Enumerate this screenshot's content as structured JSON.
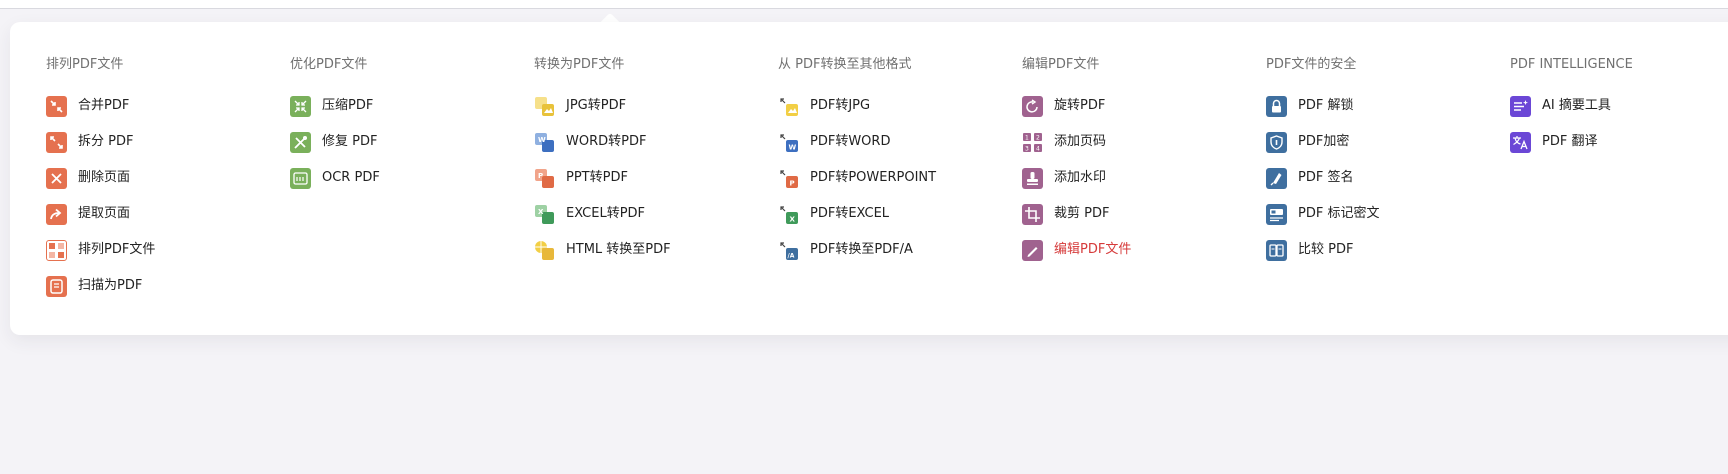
{
  "colors": {
    "organize": "#e5714f",
    "optimize": "#7ab05b",
    "convert_to": "#e8b83a",
    "edit": "#a0628f",
    "security": "#3f6f9f",
    "intelligence": "#6b47d6",
    "active_text": "#d63b3b"
  },
  "columns": [
    {
      "title": "排列PDF文件",
      "items": [
        {
          "label": "合并PDF",
          "icon": "merge-icon"
        },
        {
          "label": "拆分 PDF",
          "icon": "split-icon"
        },
        {
          "label": "删除页面",
          "icon": "remove-icon"
        },
        {
          "label": "提取页面",
          "icon": "extract-icon"
        },
        {
          "label": "排列PDF文件",
          "icon": "organize-icon"
        },
        {
          "label": "扫描为PDF",
          "icon": "scan-icon"
        }
      ]
    },
    {
      "title": "优化PDF文件",
      "items": [
        {
          "label": "压缩PDF",
          "icon": "compress-icon"
        },
        {
          "label": "修复 PDF",
          "icon": "repair-icon"
        },
        {
          "label": "OCR PDF",
          "icon": "ocr-icon"
        }
      ]
    },
    {
      "title": "转换为PDF文件",
      "items": [
        {
          "label": "JPG转PDF",
          "icon": "jpg-to-pdf-icon"
        },
        {
          "label": "WORD转PDF",
          "icon": "word-to-pdf-icon"
        },
        {
          "label": "PPT转PDF",
          "icon": "ppt-to-pdf-icon"
        },
        {
          "label": "EXCEL转PDF",
          "icon": "excel-to-pdf-icon"
        },
        {
          "label": "HTML 转换至PDF",
          "icon": "html-to-pdf-icon"
        }
      ]
    },
    {
      "title": "从 PDF转换至其他格式",
      "items": [
        {
          "label": "PDF转JPG",
          "icon": "pdf-to-jpg-icon"
        },
        {
          "label": "PDF转WORD",
          "icon": "pdf-to-word-icon"
        },
        {
          "label": "PDF转POWERPOINT",
          "icon": "pdf-to-powerpoint-icon"
        },
        {
          "label": "PDF转EXCEL",
          "icon": "pdf-to-excel-icon"
        },
        {
          "label": "PDF转换至PDF/A",
          "icon": "pdf-to-pdfa-icon"
        }
      ]
    },
    {
      "title": "编辑PDF文件",
      "items": [
        {
          "label": "旋转PDF",
          "icon": "rotate-icon"
        },
        {
          "label": "添加页码",
          "icon": "page-numbers-icon"
        },
        {
          "label": "添加水印",
          "icon": "watermark-icon"
        },
        {
          "label": "裁剪 PDF",
          "icon": "crop-icon"
        },
        {
          "label": "编辑PDF文件",
          "icon": "edit-pencil-icon",
          "active": true
        }
      ]
    },
    {
      "title": "PDF文件的安全",
      "items": [
        {
          "label": "PDF 解锁",
          "icon": "unlock-icon"
        },
        {
          "label": "PDF加密",
          "icon": "protect-shield-icon"
        },
        {
          "label": "PDF 签名",
          "icon": "sign-pen-icon"
        },
        {
          "label": "PDF 标记密文",
          "icon": "redact-icon"
        },
        {
          "label": "比较 PDF",
          "icon": "compare-icon"
        }
      ]
    },
    {
      "title": "PDF INTELLIGENCE",
      "items": [
        {
          "label": "AI 摘要工具",
          "icon": "ai-summary-icon"
        },
        {
          "label": "PDF 翻译",
          "icon": "translate-icon"
        }
      ]
    }
  ]
}
